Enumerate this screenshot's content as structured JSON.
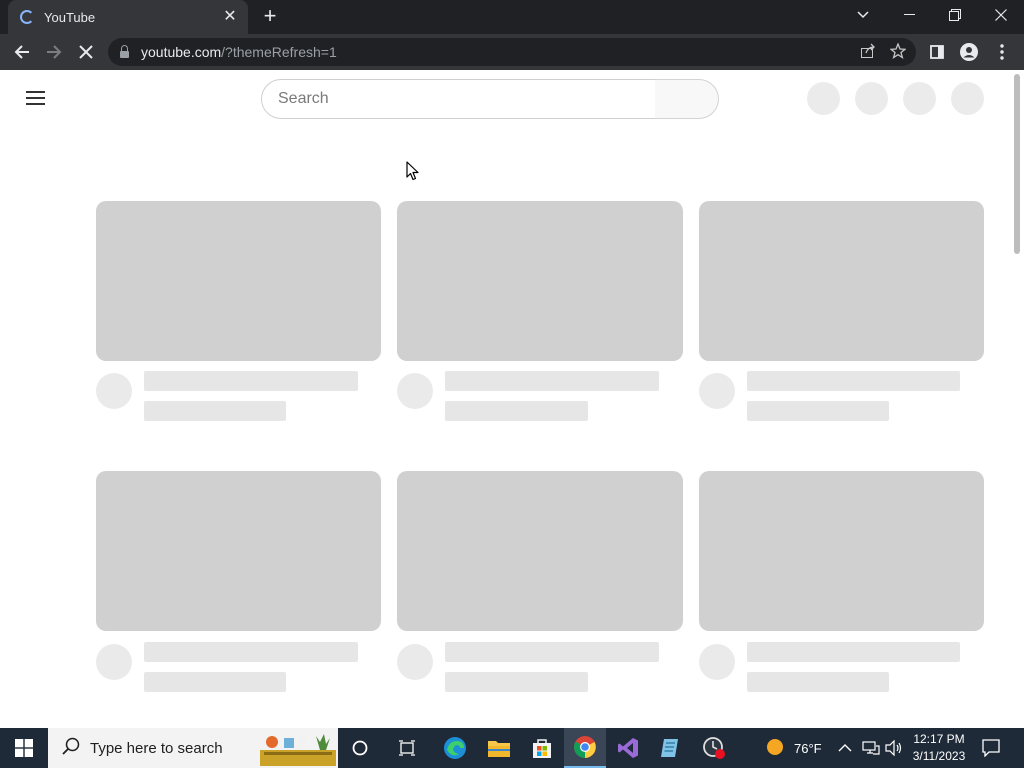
{
  "browser": {
    "tab_title": "YouTube",
    "tab_close": "✕",
    "new_tab": "+",
    "url_host": "youtube.com",
    "url_path": "/?themeRefresh=1"
  },
  "youtube": {
    "search_placeholder": "Search"
  },
  "taskbar": {
    "search_placeholder": "Type here to search",
    "weather": "76°F",
    "time": "12:17 PM",
    "date": "3/11/2023"
  },
  "colors": {
    "chrome_dark": "#202124",
    "chrome_toolbar": "#35363a",
    "skeleton_thumb": "#d0d0d0",
    "skeleton_line": "#e6e6e6",
    "taskbar": "#1f2a38"
  }
}
